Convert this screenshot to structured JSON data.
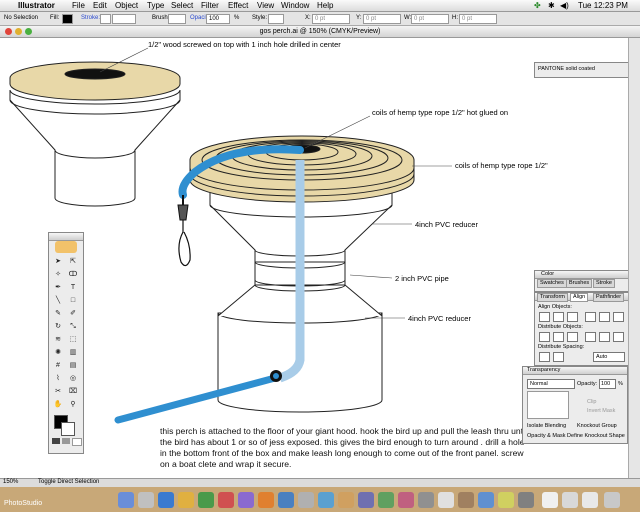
{
  "menubar": {
    "app": "Illustrator",
    "items": [
      "File",
      "Edit",
      "Object",
      "Type",
      "Select",
      "Filter",
      "Effect",
      "View",
      "Window",
      "Help"
    ],
    "clock": "Tue 12:23 PM"
  },
  "control_bar": {
    "selection": "No Selection",
    "fill_label": "Fill:",
    "stroke_label": "Stroke:",
    "brush_label": "Brush:",
    "opacity_label": "Opacity:",
    "opacity_value": "100",
    "percent": "%",
    "style_label": "Style:",
    "x_label": "X:",
    "x_value": "0 pt",
    "y_label": "Y:",
    "y_value": "0 pt",
    "w_label": "W:",
    "w_value": "0 pt",
    "h_label": "H:",
    "h_value": "0 pt"
  },
  "document": {
    "title": "gos perch.ai @ 150% (CMYK/Preview)"
  },
  "annotations": {
    "top_wood": "1/2\" wood screwed on top with 1 inch hole drilled in center",
    "coils_hot_glued": "coils of hemp type rope 1/2\" hot glued on",
    "coils": "coils of hemp type rope 1/2\"",
    "reducer_top": "4inch PVC reducer",
    "pipe": "2 inch PVC pipe",
    "reducer_bottom": "4inch PVC reducer"
  },
  "caption": "this perch is attached to the floor of your giant hood. hook the bird up  and pull the leash thru until the bird has about 1 or so of jess exposed. this gives the bird enough to turn around .  drill a hole in the bottom front of the box and make leash long enough to come out of the front panel.  screw on a boat clete and wrap it secure.",
  "palettes": {
    "pantone": "PANTONE solid coated",
    "color_tab": "Color",
    "swatches_tab": "Swatches",
    "brushes_tab": "Brushes",
    "stroke_tab": "Stroke",
    "transform_tab": "Transform",
    "align_tab": "Align",
    "pathfinder_tab": "Pathfinder",
    "align_objects": "Align Objects:",
    "distribute_objects": "Distribute Objects:",
    "distribute_spacing": "Distribute Spacing:",
    "spacing_value": "Auto",
    "transparency_title": "Transparency",
    "blend_mode": "Normal",
    "opacity_label": "Opacity:",
    "opacity_value": "100",
    "percent": "%",
    "clip": "Clip",
    "invert_mask": "Invert Mask",
    "isolate_blending": "Isolate Blending",
    "knockout_group": "Knockout Group",
    "opacity_mask_define": "Opacity & Mask Define Knockout Shape"
  },
  "status": {
    "zoom": "150%",
    "tool_status": "Toggle Direct Selection"
  },
  "desktop": {
    "label": "PhotoStudio"
  },
  "colors": {
    "rope_blue": "#2f8fd0",
    "leash_light": "#a8cce8",
    "wood": "#e8d8a8",
    "desktop_sand": "#c8a878"
  }
}
